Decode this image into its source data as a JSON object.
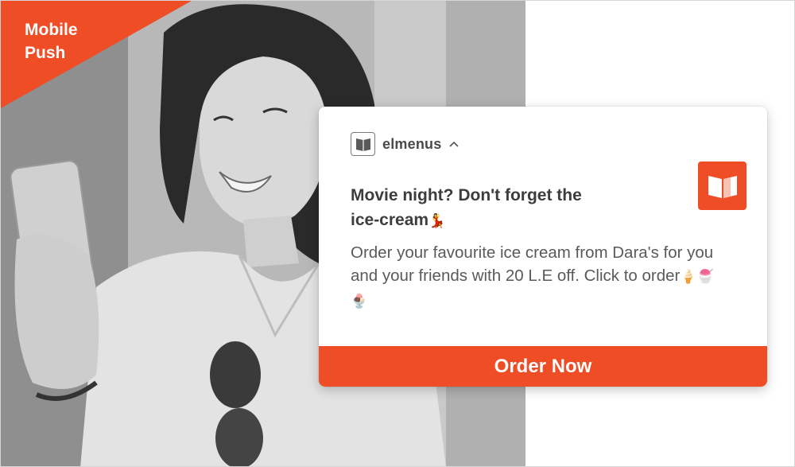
{
  "colors": {
    "accent": "#ee4d26",
    "text_dark": "#3d3d3d",
    "text_body": "#5a5a5a"
  },
  "corner_banner": {
    "line1": "Mobile",
    "line2": "Push"
  },
  "notification": {
    "app_icon": "book-icon",
    "app_name": "elmenus",
    "expand_icon": "chevron-up-icon",
    "thumbnail_icon": "open-book-icon",
    "title_line1": "Movie night? Don't forget the",
    "title_line2": "ice-cream",
    "title_emoji": "💃",
    "body": "Order your favourite ice cream from Dara's for you and your friends with 20 L.E off. Click to order",
    "body_emojis": "🍦🍧🍨",
    "cta_label": "Order Now"
  }
}
